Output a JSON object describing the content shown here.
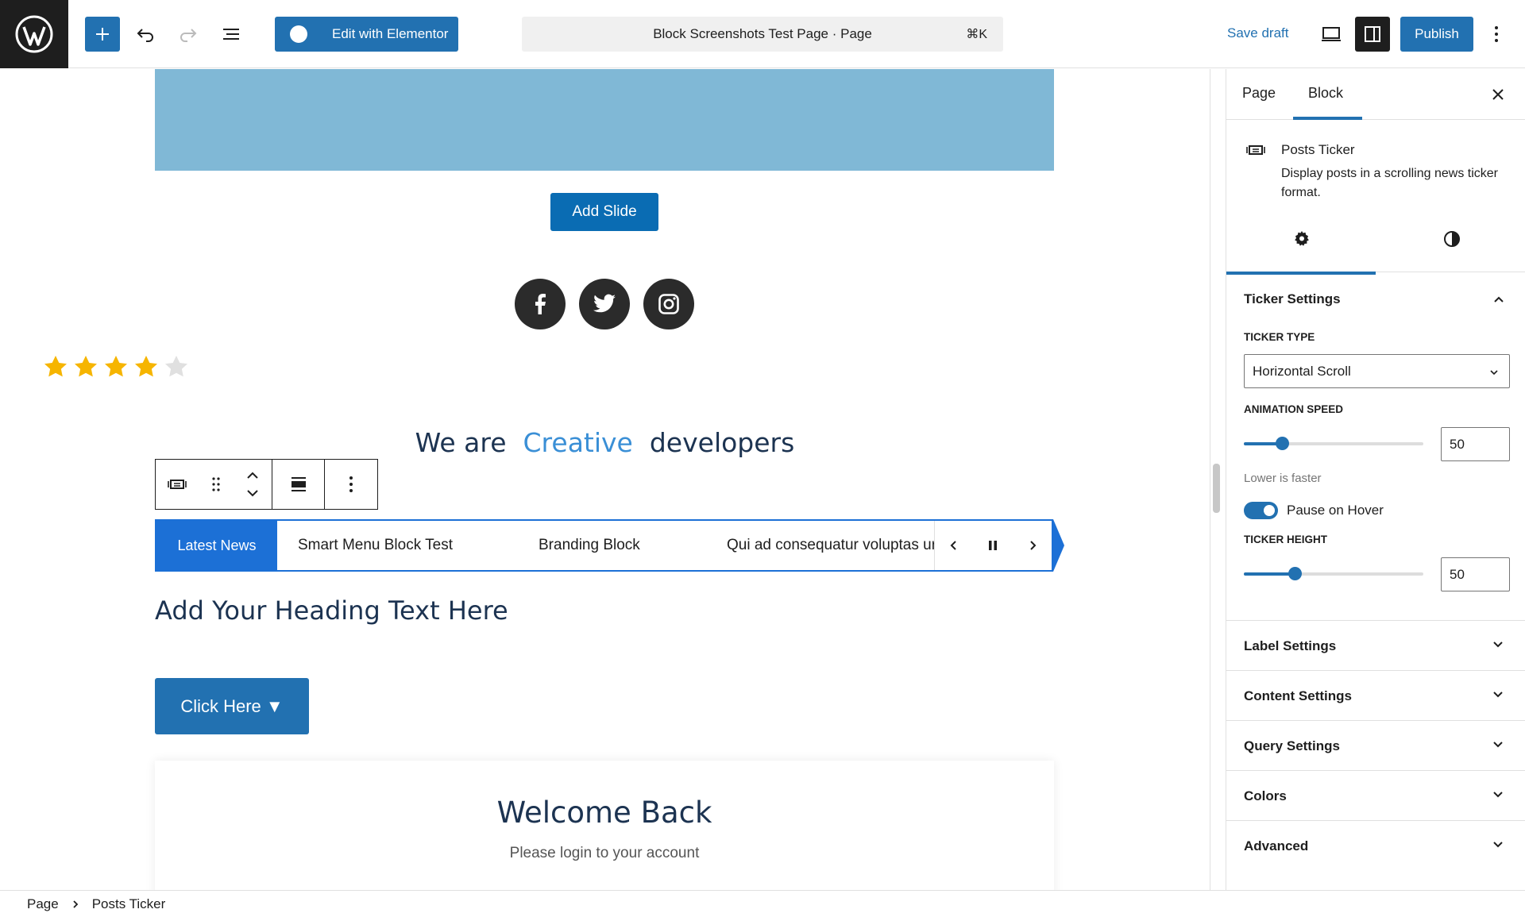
{
  "topbar": {
    "elementor_label": "Edit with Elementor",
    "command_text": "Block Screenshots Test Page · Page",
    "command_shortcut": "⌘K",
    "save_draft": "Save draft",
    "publish": "Publish",
    "accent_color": "#2271b1"
  },
  "canvas": {
    "add_slide": "Add Slide",
    "social": [
      "facebook-icon",
      "twitter-icon",
      "instagram-icon"
    ],
    "rating_value": 4,
    "rating_max": 5,
    "hero_before": "We are",
    "hero_accent": "Creative",
    "hero_after": "developers",
    "ticker_label": "Latest News",
    "ticker_items": [
      "Smart Menu Block Test",
      "Branding Block",
      "Qui ad consequatur voluptas ur"
    ],
    "heading": "Add Your Heading Text Here",
    "click_button": "Click Here ▼",
    "login_title": "Welcome Back",
    "login_sub": "Please login to your account"
  },
  "sidebar": {
    "tabs": [
      "Page",
      "Block"
    ],
    "block_title": "Posts Ticker",
    "block_desc": "Display posts in a scrolling news ticker format.",
    "ticker_settings_title": "Ticker Settings",
    "ticker_type_label": "TICKER TYPE",
    "ticker_type_value": "Horizontal Scroll",
    "animation_speed_label": "ANIMATION SPEED",
    "animation_speed_value": "50",
    "animation_speed_help": "Lower is faster",
    "pause_label": "Pause on Hover",
    "ticker_height_label": "TICKER HEIGHT",
    "ticker_height_value": "50",
    "panels": [
      "Label Settings",
      "Content Settings",
      "Query Settings",
      "Colors",
      "Advanced"
    ]
  },
  "breadcrumb": {
    "root": "Page",
    "current": "Posts Ticker"
  }
}
